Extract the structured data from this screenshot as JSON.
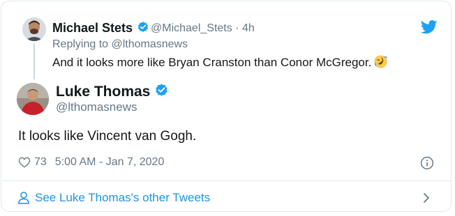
{
  "parent_tweet": {
    "author_name": "Michael Stets",
    "author_handle": "@Michael_Stets",
    "age": "· 4h",
    "replying_to": "Replying to @lthomasnews",
    "text": "And it looks more like Bryan Cranston than Conor McGregor.",
    "emoji": "rolling-on-floor-laughing-emoji"
  },
  "tweet": {
    "author_name": "Luke Thomas",
    "author_handle": "@lthomasnews",
    "text": "It looks like Vincent van Gogh.",
    "like_count": "73",
    "timestamp": "5:00 AM - Jan 7, 2020"
  },
  "footer": {
    "link_label": "See Luke Thomas's other Tweets"
  },
  "colors": {
    "accent": "#1da1f2",
    "link": "#1b95e0",
    "muted": "#657786",
    "text": "#14171a",
    "border": "#e1e8ed"
  }
}
